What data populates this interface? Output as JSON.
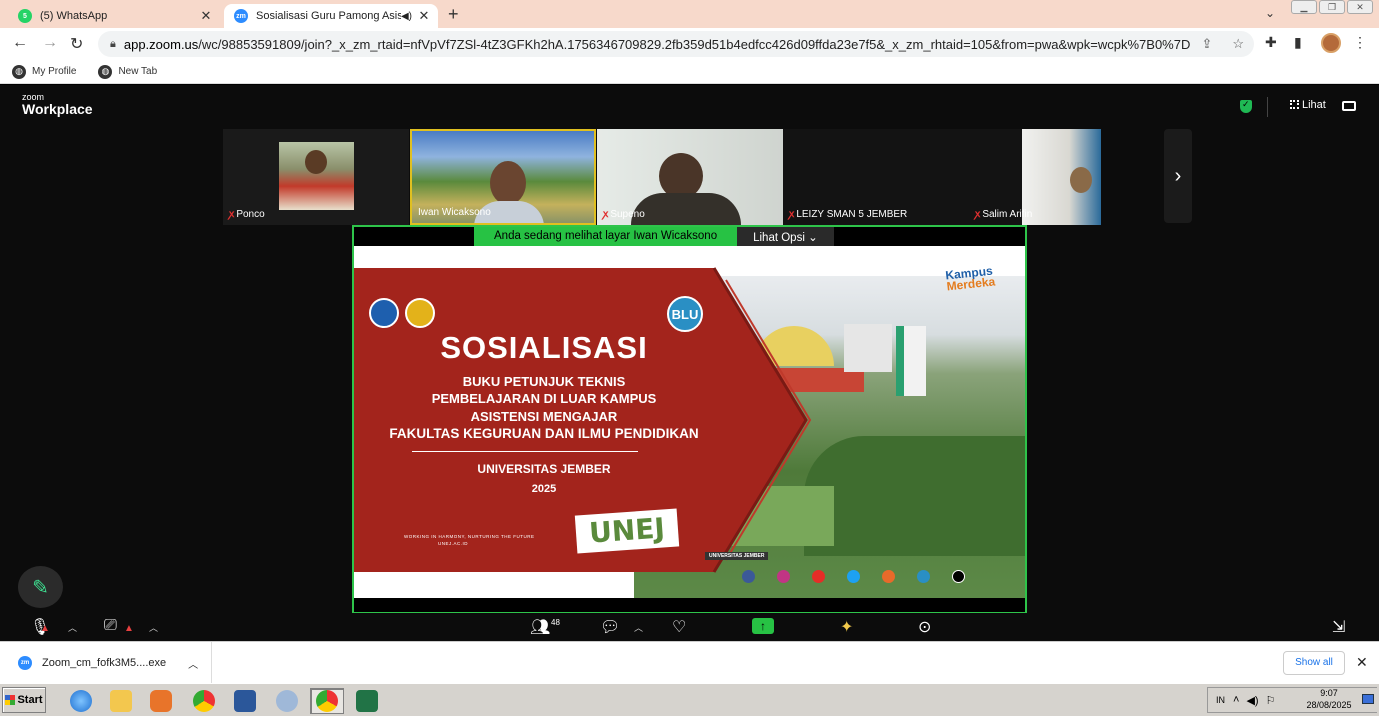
{
  "browser": {
    "tabs": [
      {
        "title": "(5) WhatsApp",
        "favicon": "whatsapp-icon",
        "favicon_text": "5",
        "active": false
      },
      {
        "title": "Sosialisasi Guru Pamong Asisten",
        "favicon": "zoom-icon",
        "favicon_text": "zm",
        "active": true
      }
    ],
    "url_host": "app.zoom.us",
    "url_rest": "/wc/98853591809/join?_x_zm_rtaid=nfVpVf7ZSl-4tZ3GFKh2hA.1756346709829.2fb359d51b4edfcc426d09ffda23e7f5&_x_zm_rhtaid=105&from=pwa&wpk=wcpk%7B0%7D...",
    "bookmarks": [
      "My Profile",
      "New Tab"
    ]
  },
  "zoom": {
    "brand_top": "zoom",
    "brand_bottom": "Workplace",
    "view_label": "Lihat",
    "participants": [
      {
        "name": "Ponco",
        "muted": true
      },
      {
        "name": "Iwan Wicaksono",
        "muted": false,
        "active": true
      },
      {
        "name": "Supeno",
        "muted": true
      },
      {
        "name": "LEIZY SMAN 5 JEMBER",
        "muted": true
      },
      {
        "name": "Salim Arifin",
        "muted": true
      }
    ],
    "share_banner": "Anda sedang melihat layar  Iwan Wicaksono",
    "view_options": "Lihat Opsi",
    "participant_count": "48"
  },
  "slide": {
    "title": "SOSIALISASI",
    "lines": [
      "BUKU PETUNJUK TEKNIS",
      "PEMBELAJARAN DI LUAR KAMPUS",
      "ASISTENSI MENGAJAR",
      "FAKULTAS KEGURUAN DAN ILMU PENDIDIKAN"
    ],
    "university": "UNIVERSITAS JEMBER",
    "year": "2025",
    "blu": "BLU",
    "tagline": "WORKING IN HARMONY, NURTURING THE FUTURE",
    "website": "UNEJ.AC.ID",
    "stamp": "UNEJ",
    "kampus_top": "Kampus",
    "kampus_bottom": "Merdeka",
    "building_label": "UNIVERSITAS JEMBER"
  },
  "download": {
    "filename": "Zoom_cm_fofk3M5....exe",
    "show_all": "Show all"
  },
  "taskbar": {
    "start": "Start",
    "lang": "IN",
    "time": "9:07",
    "date": "28/08/2025"
  },
  "colors": {
    "zoom_green": "#27c244",
    "slide_red": "#a3241c",
    "tab_strip": "#f7d9cb"
  }
}
